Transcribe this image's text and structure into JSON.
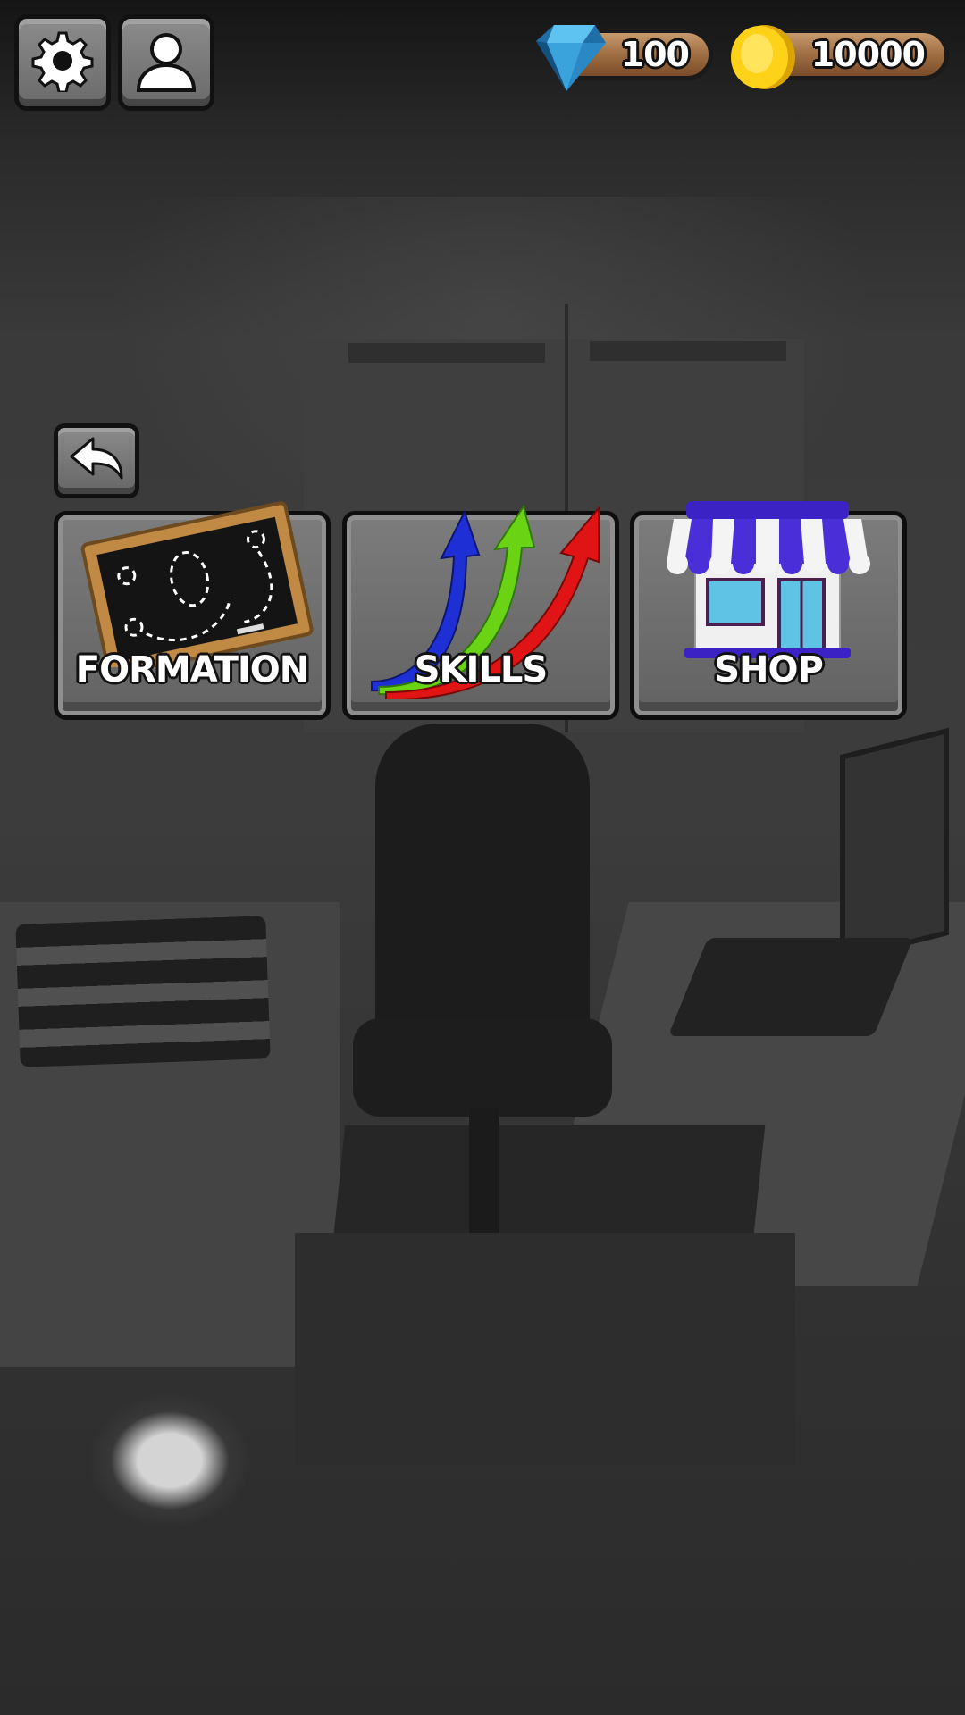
{
  "hud": {
    "settings_icon": "gear-icon",
    "profile_icon": "user-icon",
    "gems": {
      "icon": "diamond-icon",
      "value": "100"
    },
    "coins": {
      "icon": "gold-coin-icon",
      "value": "10000"
    }
  },
  "back": {
    "icon": "back-arrow-icon"
  },
  "menu": [
    {
      "label": "FORMATION",
      "icon": "chalkboard-icon"
    },
    {
      "label": "SKILLS",
      "icon": "rising-arrows-icon"
    },
    {
      "label": "SHOP",
      "icon": "storefront-icon"
    }
  ]
}
